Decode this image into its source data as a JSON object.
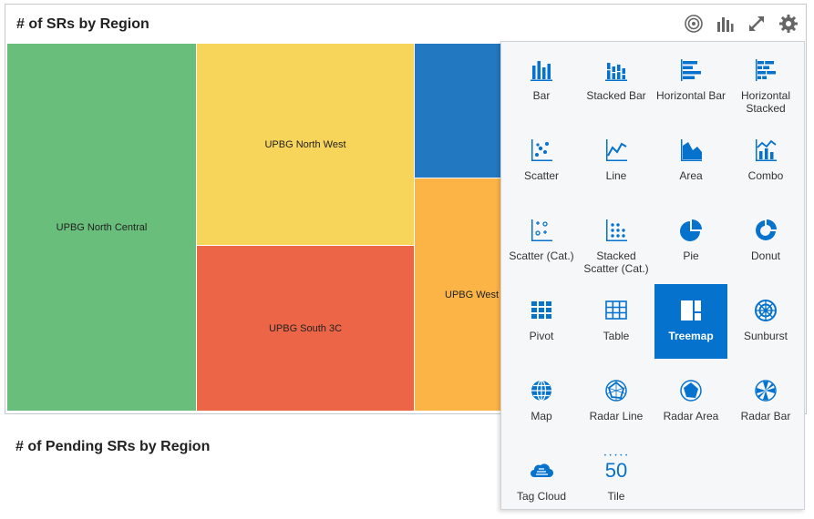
{
  "panel": {
    "title": "# of SRs by Region"
  },
  "treemap": {
    "regions": [
      {
        "label": "UPBG North Central",
        "color": "#68be7a"
      },
      {
        "label": "UPBG North West",
        "color": "#f7d45a"
      },
      {
        "label": "UPBG South 3C",
        "color": "#ec6547"
      },
      {
        "label": "",
        "color": "#2279c1"
      },
      {
        "label": "UPBG West",
        "color": "#fdb447"
      }
    ]
  },
  "header_icons": [
    "target-icon",
    "chart-bars-icon",
    "expand-icon",
    "gear-icon"
  ],
  "bottom": {
    "title": "# of Pending SRs by Region"
  },
  "chart_menu": {
    "selected": "Treemap",
    "items": [
      {
        "label": "Bar",
        "icon": "bar-chart-icon"
      },
      {
        "label": "Stacked Bar",
        "icon": "stacked-bar-icon"
      },
      {
        "label": "Horizontal Bar",
        "icon": "horizontal-bar-icon"
      },
      {
        "label": "Horizontal Stacked",
        "icon": "horizontal-stacked-icon"
      },
      {
        "label": "Scatter",
        "icon": "scatter-icon"
      },
      {
        "label": "Line",
        "icon": "line-icon"
      },
      {
        "label": "Area",
        "icon": "area-icon"
      },
      {
        "label": "Combo",
        "icon": "combo-icon"
      },
      {
        "label": "Scatter (Cat.)",
        "icon": "scatter-cat-icon"
      },
      {
        "label": "Stacked Scatter (Cat.)",
        "icon": "stacked-scatter-icon"
      },
      {
        "label": "Pie",
        "icon": "pie-icon"
      },
      {
        "label": "Donut",
        "icon": "donut-icon"
      },
      {
        "label": "Pivot",
        "icon": "pivot-icon"
      },
      {
        "label": "Table",
        "icon": "table-icon"
      },
      {
        "label": "Treemap",
        "icon": "treemap-icon"
      },
      {
        "label": "Sunburst",
        "icon": "sunburst-icon"
      },
      {
        "label": "Map",
        "icon": "map-icon"
      },
      {
        "label": "Radar Line",
        "icon": "radar-line-icon"
      },
      {
        "label": "Radar Area",
        "icon": "radar-area-icon"
      },
      {
        "label": "Radar Bar",
        "icon": "radar-bar-icon"
      },
      {
        "label": "Tag Cloud",
        "icon": "tag-cloud-icon"
      },
      {
        "label": "Tile",
        "icon": "tile-icon"
      }
    ],
    "tile_value": "50"
  }
}
